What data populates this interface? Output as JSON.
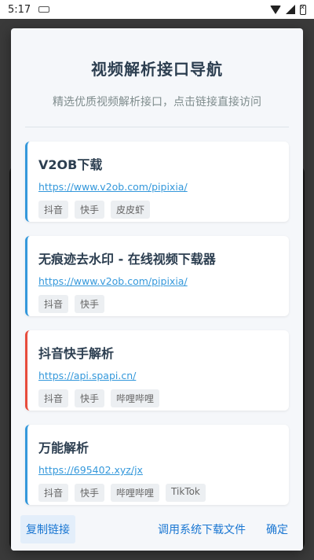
{
  "status": {
    "time": "5:17"
  },
  "dialog": {
    "title": "视频解析接口导航",
    "subtitle": "精选优质视频解析接口，点击链接直接访问"
  },
  "cards": [
    {
      "title": "V2OB下载",
      "url": "https://www.v2ob.com/pipixia/",
      "tags": [
        "抖音",
        "快手",
        "皮皮虾"
      ]
    },
    {
      "title": "无痕迹去水印 - 在线视频下载器",
      "url": "https://www.v2ob.com/pipixia/",
      "tags": [
        "抖音",
        "快手"
      ]
    },
    {
      "title": "抖音快手解析",
      "url": "https://api.spapi.cn/",
      "tags": [
        "抖音",
        "快手",
        "哔哩哔哩"
      ]
    },
    {
      "title": "万能解析",
      "url": "https://695402.xyz/jx",
      "tags": [
        "抖音",
        "快手",
        "哔哩哔哩",
        "TikTok"
      ]
    }
  ],
  "footer": {
    "copy_label": "复制链接",
    "system_download_label": "调用系统下载文件",
    "ok_label": "确定"
  },
  "colors": {
    "accent": "#3498db",
    "highlight": "#e74c3c",
    "button": "#1976d2"
  }
}
